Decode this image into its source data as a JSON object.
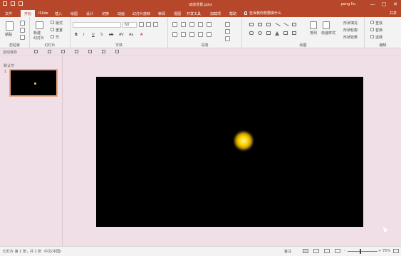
{
  "window": {
    "title": "动态背景.pptx",
    "user": "peng liu",
    "controls": [
      "—",
      "□",
      "✕"
    ]
  },
  "tabs": [
    {
      "label": "文件",
      "active": false
    },
    {
      "label": "开始",
      "active": true
    },
    {
      "label": "iSlide",
      "active": false
    },
    {
      "label": "插入",
      "active": false
    },
    {
      "label": "绘图",
      "active": false
    },
    {
      "label": "设计",
      "active": false
    },
    {
      "label": "切换",
      "active": false
    },
    {
      "label": "动画",
      "active": false
    },
    {
      "label": "幻灯片放映",
      "active": false
    },
    {
      "label": "审阅",
      "active": false
    },
    {
      "label": "视图",
      "active": false
    },
    {
      "label": "开发工具",
      "active": false
    },
    {
      "label": "加载项",
      "active": false
    },
    {
      "label": "帮助",
      "active": false
    }
  ],
  "tellme": "告诉我你想要做什么",
  "share": "共享",
  "ribbon": {
    "clipboard": {
      "label": "剪贴板",
      "paste": "粘贴"
    },
    "slides": {
      "label": "幻灯片",
      "new_slide": "新建\n幻灯片",
      "layout": "版式",
      "reset": "重置",
      "section": "节"
    },
    "font": {
      "label": "字体",
      "font_name": "",
      "font_size": "60",
      "buttons": [
        "B",
        "I",
        "U",
        "S",
        "ab",
        "AV",
        "Aa",
        "A"
      ]
    },
    "paragraph": {
      "label": "段落"
    },
    "drawing": {
      "label": "绘图",
      "arrange": "排列",
      "quick_styles": "快速样式",
      "fill": "形状填充",
      "outline": "形状轮廓",
      "effects": "形状效果"
    },
    "editing": {
      "label": "编辑",
      "find": "查找",
      "replace": "替换",
      "select": "选择"
    }
  },
  "quick_access_label": "自动保存",
  "thumbnails": {
    "section": "默认节",
    "slides": [
      {
        "number": "1"
      }
    ]
  },
  "status": {
    "slide_info": "幻灯片 第 1 张，共 1 张",
    "language": "中文(中国)",
    "notes": "备注",
    "zoom": "75%"
  },
  "colors": {
    "accent": "#b7472a",
    "slide_bg": "#000000",
    "glow": "#ffd300"
  }
}
